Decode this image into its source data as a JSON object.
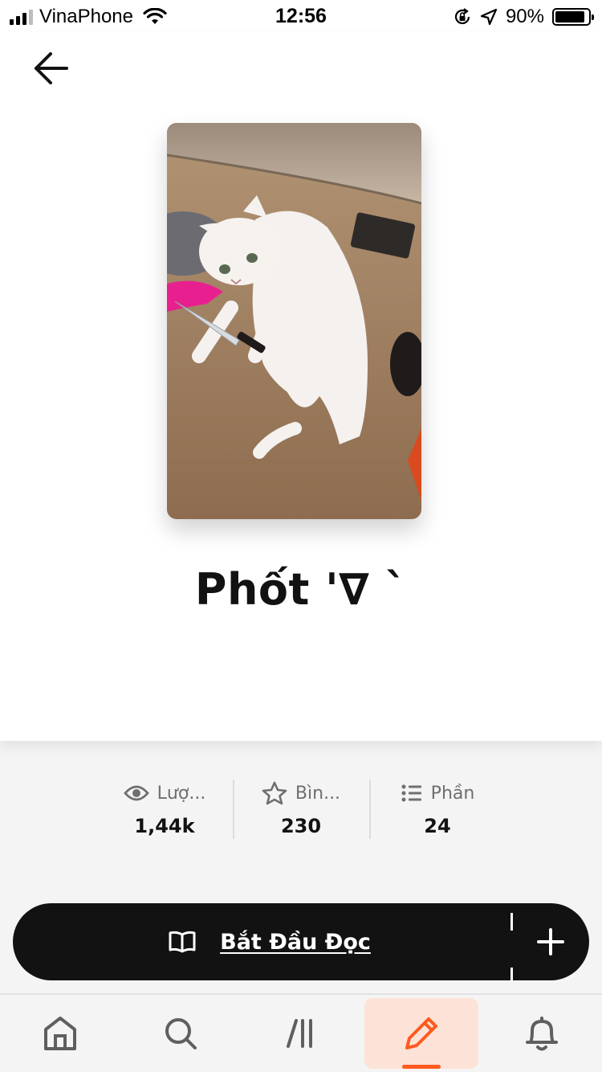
{
  "status_bar": {
    "carrier": "VinaPhone",
    "time": "12:56",
    "battery": "90%",
    "battery_level": 0.9
  },
  "story": {
    "title": "Phốt '∇ `",
    "cover_alt": "Cover image: white cat holding a knife"
  },
  "stats": [
    {
      "icon": "eye-icon",
      "label": "Lượ...",
      "value": "1,44k"
    },
    {
      "icon": "star-icon",
      "label": "Bìn...",
      "value": "230"
    },
    {
      "icon": "list-icon",
      "label": "Phần",
      "value": "24"
    }
  ],
  "actions": {
    "read_label": "Bắt Đầu Đọc"
  },
  "nav": {
    "items": [
      "home-icon",
      "search-icon",
      "library-icon",
      "write-icon",
      "bell-icon"
    ],
    "active": "write-icon"
  },
  "colors": {
    "accent": "#ff5a1f",
    "active_bg": "#fde3d7",
    "bar_bg": "#121212"
  }
}
